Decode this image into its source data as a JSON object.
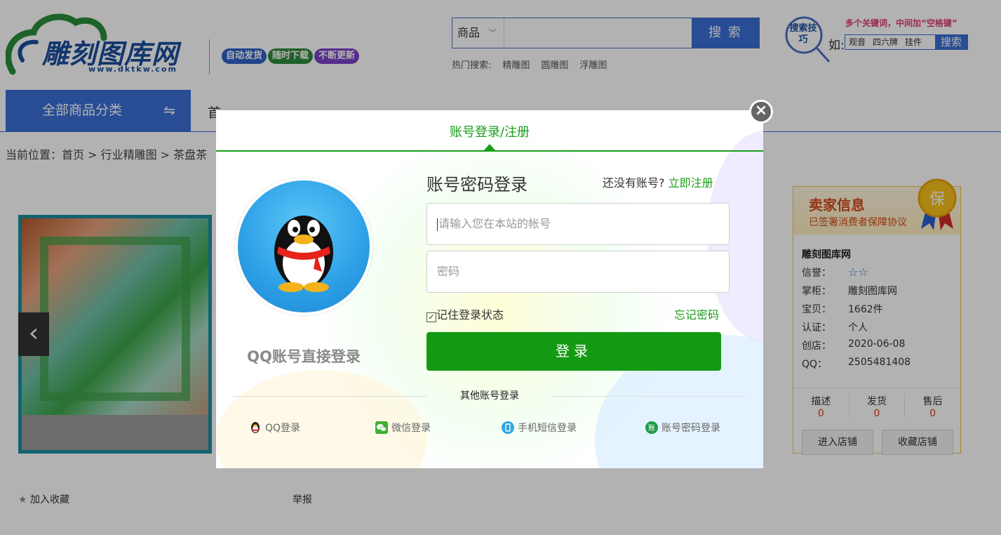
{
  "header": {
    "logo_text": "雕刻图库网",
    "logo_url": "www.dktkw.com",
    "badges": [
      "自动发货",
      "随时下载",
      "不断更新"
    ],
    "search": {
      "category": "商品",
      "placeholder": "",
      "button": "搜 索",
      "hot_label": "热门搜索:",
      "hot_terms": [
        "精雕图",
        "圆雕图",
        "浮雕图"
      ]
    },
    "tips": {
      "title": "搜索技巧",
      "hint": "多个关键词，中间加“空格键”",
      "ru": "如:",
      "examples": [
        "观音",
        "四六牌",
        "挂件"
      ],
      "button": "搜索"
    }
  },
  "nav": {
    "all_categories": "全部商品分类",
    "swap_icon": "⇋",
    "first_item": "首"
  },
  "breadcrumb": "当前位置：首页 > 行业精雕图 > 茶盘茶",
  "product": {
    "favorite": "加入收藏",
    "report": "举报",
    "prev_icon": "‹"
  },
  "shop": {
    "title": "卖家信息",
    "subtitle": "已签署消费者保障协议",
    "medal": "保",
    "name": "雕刻图库网",
    "rows": [
      {
        "label": "信誉：",
        "value": "☆☆"
      },
      {
        "label": "掌柜：",
        "value": "雕刻图库网"
      },
      {
        "label": "宝贝：",
        "value": "1662件"
      },
      {
        "label": "认证：",
        "value": "个人"
      },
      {
        "label": "创店：",
        "value": "2020-06-08"
      },
      {
        "label": "QQ：",
        "value": "2505481408"
      }
    ],
    "scores": [
      {
        "label": "描述",
        "value": "0"
      },
      {
        "label": "发货",
        "value": "0"
      },
      {
        "label": "售后",
        "value": "0"
      }
    ],
    "btn_enter": "进入店铺",
    "btn_fav": "收藏店铺"
  },
  "modal": {
    "tab": "账号登录/注册",
    "qq_label": "QQ账号直接登录",
    "title": "账号密码登录",
    "no_account": "还没有账号?",
    "register": "立即注册",
    "username_placeholder": "请输入您在本站的帐号",
    "password_placeholder": "密码",
    "remember": "记住登录状态",
    "remember_check": "☑",
    "forgot": "忘记密码",
    "login_button": "登录",
    "other_label": "其他账号登录",
    "socials": [
      {
        "label": "QQ登录",
        "icon": "qq-icon"
      },
      {
        "label": "微信登录",
        "icon": "wechat-icon"
      },
      {
        "label": "手机短信登录",
        "icon": "phone-icon"
      },
      {
        "label": "账号密码登录",
        "icon": "account-icon"
      }
    ],
    "close": "×"
  },
  "colors": {
    "brand_blue": "#3a6fd6",
    "login_green": "#129a12",
    "overlay": "rgba(0,0,0,0.30)"
  }
}
